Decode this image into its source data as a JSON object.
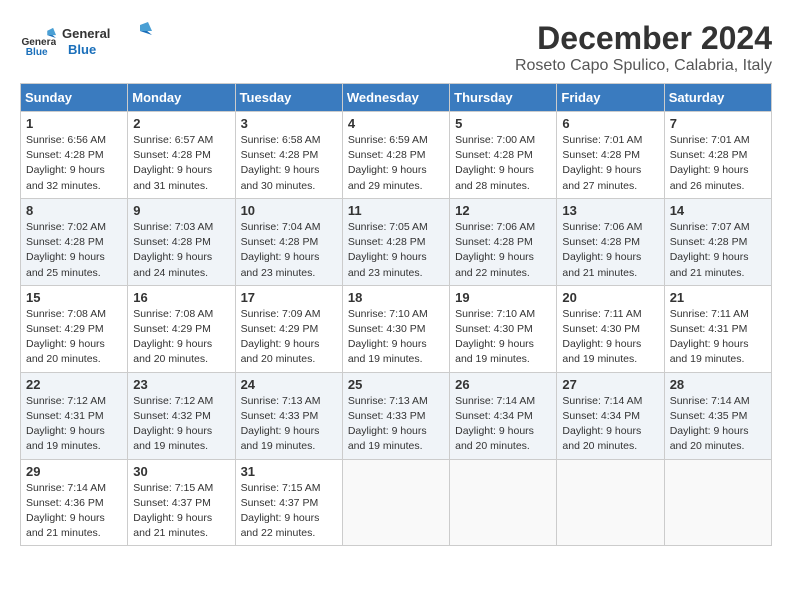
{
  "logo": {
    "line1": "General",
    "line2": "Blue"
  },
  "title": "December 2024",
  "subtitle": "Roseto Capo Spulico, Calabria, Italy",
  "days_of_week": [
    "Sunday",
    "Monday",
    "Tuesday",
    "Wednesday",
    "Thursday",
    "Friday",
    "Saturday"
  ],
  "weeks": [
    [
      {
        "day": 1,
        "sunrise": "6:56 AM",
        "sunset": "4:28 PM",
        "daylight": "9 hours and 32 minutes."
      },
      {
        "day": 2,
        "sunrise": "6:57 AM",
        "sunset": "4:28 PM",
        "daylight": "9 hours and 31 minutes."
      },
      {
        "day": 3,
        "sunrise": "6:58 AM",
        "sunset": "4:28 PM",
        "daylight": "9 hours and 30 minutes."
      },
      {
        "day": 4,
        "sunrise": "6:59 AM",
        "sunset": "4:28 PM",
        "daylight": "9 hours and 29 minutes."
      },
      {
        "day": 5,
        "sunrise": "7:00 AM",
        "sunset": "4:28 PM",
        "daylight": "9 hours and 28 minutes."
      },
      {
        "day": 6,
        "sunrise": "7:01 AM",
        "sunset": "4:28 PM",
        "daylight": "9 hours and 27 minutes."
      },
      {
        "day": 7,
        "sunrise": "7:01 AM",
        "sunset": "4:28 PM",
        "daylight": "9 hours and 26 minutes."
      }
    ],
    [
      {
        "day": 8,
        "sunrise": "7:02 AM",
        "sunset": "4:28 PM",
        "daylight": "9 hours and 25 minutes."
      },
      {
        "day": 9,
        "sunrise": "7:03 AM",
        "sunset": "4:28 PM",
        "daylight": "9 hours and 24 minutes."
      },
      {
        "day": 10,
        "sunrise": "7:04 AM",
        "sunset": "4:28 PM",
        "daylight": "9 hours and 23 minutes."
      },
      {
        "day": 11,
        "sunrise": "7:05 AM",
        "sunset": "4:28 PM",
        "daylight": "9 hours and 23 minutes."
      },
      {
        "day": 12,
        "sunrise": "7:06 AM",
        "sunset": "4:28 PM",
        "daylight": "9 hours and 22 minutes."
      },
      {
        "day": 13,
        "sunrise": "7:06 AM",
        "sunset": "4:28 PM",
        "daylight": "9 hours and 21 minutes."
      },
      {
        "day": 14,
        "sunrise": "7:07 AM",
        "sunset": "4:28 PM",
        "daylight": "9 hours and 21 minutes."
      }
    ],
    [
      {
        "day": 15,
        "sunrise": "7:08 AM",
        "sunset": "4:29 PM",
        "daylight": "9 hours and 20 minutes."
      },
      {
        "day": 16,
        "sunrise": "7:08 AM",
        "sunset": "4:29 PM",
        "daylight": "9 hours and 20 minutes."
      },
      {
        "day": 17,
        "sunrise": "7:09 AM",
        "sunset": "4:29 PM",
        "daylight": "9 hours and 20 minutes."
      },
      {
        "day": 18,
        "sunrise": "7:10 AM",
        "sunset": "4:30 PM",
        "daylight": "9 hours and 19 minutes."
      },
      {
        "day": 19,
        "sunrise": "7:10 AM",
        "sunset": "4:30 PM",
        "daylight": "9 hours and 19 minutes."
      },
      {
        "day": 20,
        "sunrise": "7:11 AM",
        "sunset": "4:30 PM",
        "daylight": "9 hours and 19 minutes."
      },
      {
        "day": 21,
        "sunrise": "7:11 AM",
        "sunset": "4:31 PM",
        "daylight": "9 hours and 19 minutes."
      }
    ],
    [
      {
        "day": 22,
        "sunrise": "7:12 AM",
        "sunset": "4:31 PM",
        "daylight": "9 hours and 19 minutes."
      },
      {
        "day": 23,
        "sunrise": "7:12 AM",
        "sunset": "4:32 PM",
        "daylight": "9 hours and 19 minutes."
      },
      {
        "day": 24,
        "sunrise": "7:13 AM",
        "sunset": "4:33 PM",
        "daylight": "9 hours and 19 minutes."
      },
      {
        "day": 25,
        "sunrise": "7:13 AM",
        "sunset": "4:33 PM",
        "daylight": "9 hours and 19 minutes."
      },
      {
        "day": 26,
        "sunrise": "7:14 AM",
        "sunset": "4:34 PM",
        "daylight": "9 hours and 20 minutes."
      },
      {
        "day": 27,
        "sunrise": "7:14 AM",
        "sunset": "4:34 PM",
        "daylight": "9 hours and 20 minutes."
      },
      {
        "day": 28,
        "sunrise": "7:14 AM",
        "sunset": "4:35 PM",
        "daylight": "9 hours and 20 minutes."
      }
    ],
    [
      {
        "day": 29,
        "sunrise": "7:14 AM",
        "sunset": "4:36 PM",
        "daylight": "9 hours and 21 minutes."
      },
      {
        "day": 30,
        "sunrise": "7:15 AM",
        "sunset": "4:37 PM",
        "daylight": "9 hours and 21 minutes."
      },
      {
        "day": 31,
        "sunrise": "7:15 AM",
        "sunset": "4:37 PM",
        "daylight": "9 hours and 22 minutes."
      },
      null,
      null,
      null,
      null
    ]
  ]
}
